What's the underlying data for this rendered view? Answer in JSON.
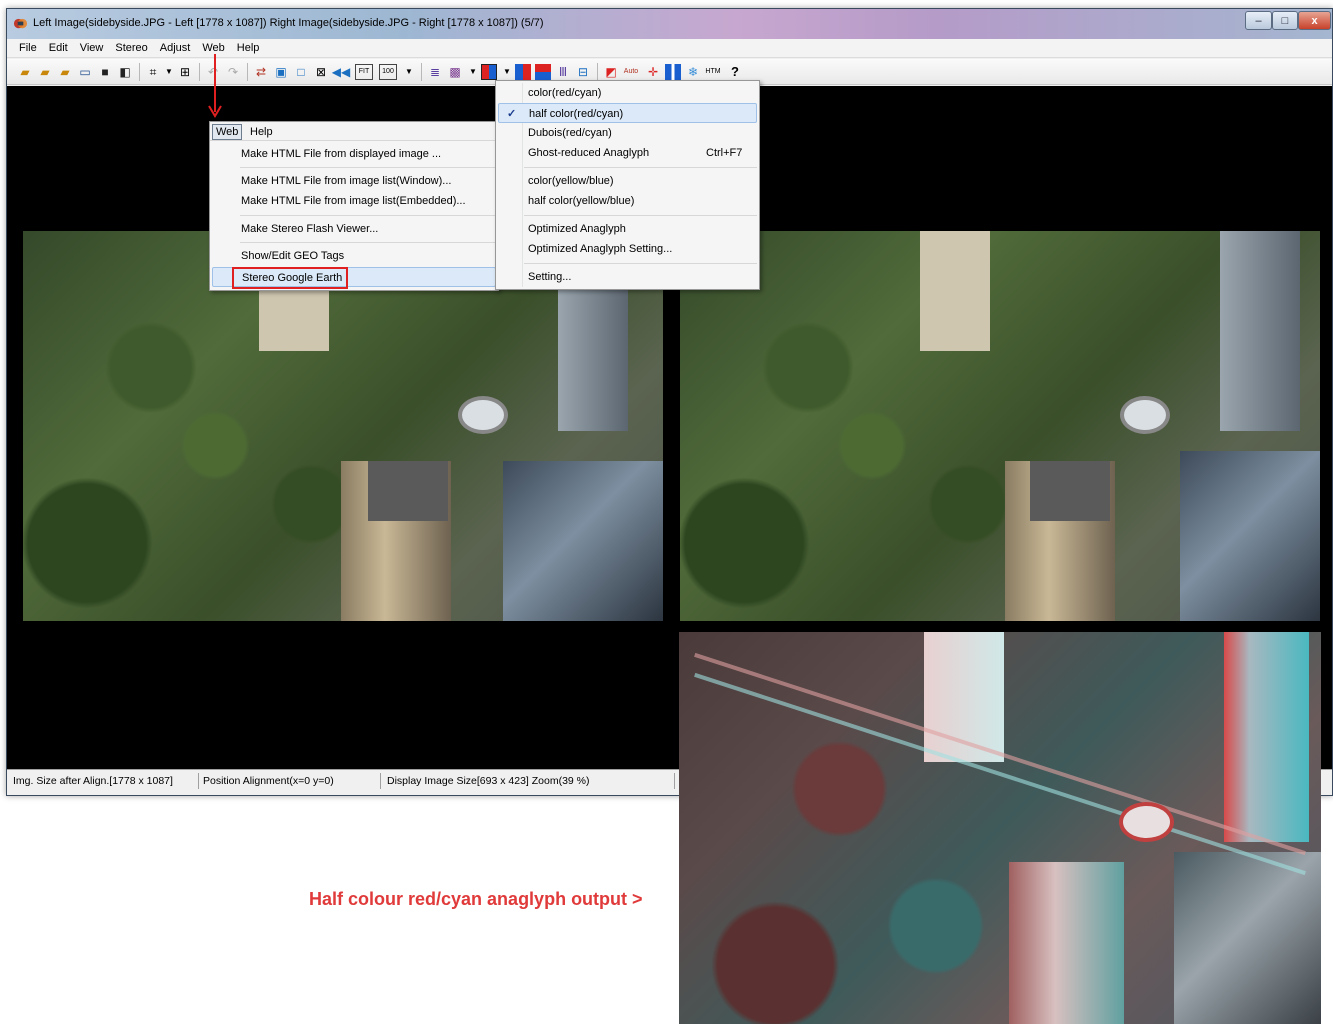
{
  "window": {
    "title": "Left Image(sidebyside.JPG - Left [1778 x 1087]) Right Image(sidebyside.JPG - Right [1778 x 1087])  (5/7)",
    "minimize_label": "–",
    "maximize_label": "□",
    "close_label": "x"
  },
  "menubar": {
    "items": [
      "File",
      "Edit",
      "View",
      "Stereo",
      "Adjust",
      "Web",
      "Help"
    ]
  },
  "web_menu": {
    "header_web": "Web",
    "header_help": "Help",
    "items": [
      "Make HTML File from displayed image ...",
      "Make HTML File from image list(Window)...",
      "Make HTML File from image list(Embedded)...",
      "Make Stereo Flash Viewer...",
      "Show/Edit GEO Tags",
      "Stereo Google Earth"
    ]
  },
  "anaglyph_menu": {
    "items": [
      {
        "label": "color(red/cyan)",
        "shortcut": "",
        "checked": false
      },
      {
        "label": "half color(red/cyan)",
        "shortcut": "",
        "checked": true
      },
      {
        "label": "Dubois(red/cyan)",
        "shortcut": "",
        "checked": false
      },
      {
        "label": "Ghost-reduced Anaglyph",
        "shortcut": "Ctrl+F7",
        "checked": false
      },
      {
        "label": "color(yellow/blue)",
        "shortcut": "",
        "checked": false
      },
      {
        "label": "half color(yellow/blue)",
        "shortcut": "",
        "checked": false
      },
      {
        "label": "Optimized Anaglyph",
        "shortcut": "",
        "checked": false
      },
      {
        "label": "Optimized Anaglyph Setting...",
        "shortcut": "",
        "checked": false
      },
      {
        "label": "Setting...",
        "shortcut": "",
        "checked": false
      }
    ],
    "check_mark": "✓"
  },
  "statusbar": {
    "img_size": "Img. Size after Align.[1778 x 1087]",
    "position_alignment": "Position Alignment(x=0 y=0)",
    "display_size": "Display Image Size[693 x 423]  Zoom(39 %)"
  },
  "toolbar": {
    "fit_label": "FIT",
    "zoom100_label": "100",
    "auto_label": "Auto",
    "htm_label": "HTM",
    "help_label": "?"
  },
  "caption": "Half colour red/cyan anaglyph output >",
  "colors": {
    "caption": "#e03a3a",
    "annotation": "#e02020",
    "menu_highlight": "#dce9f8"
  }
}
